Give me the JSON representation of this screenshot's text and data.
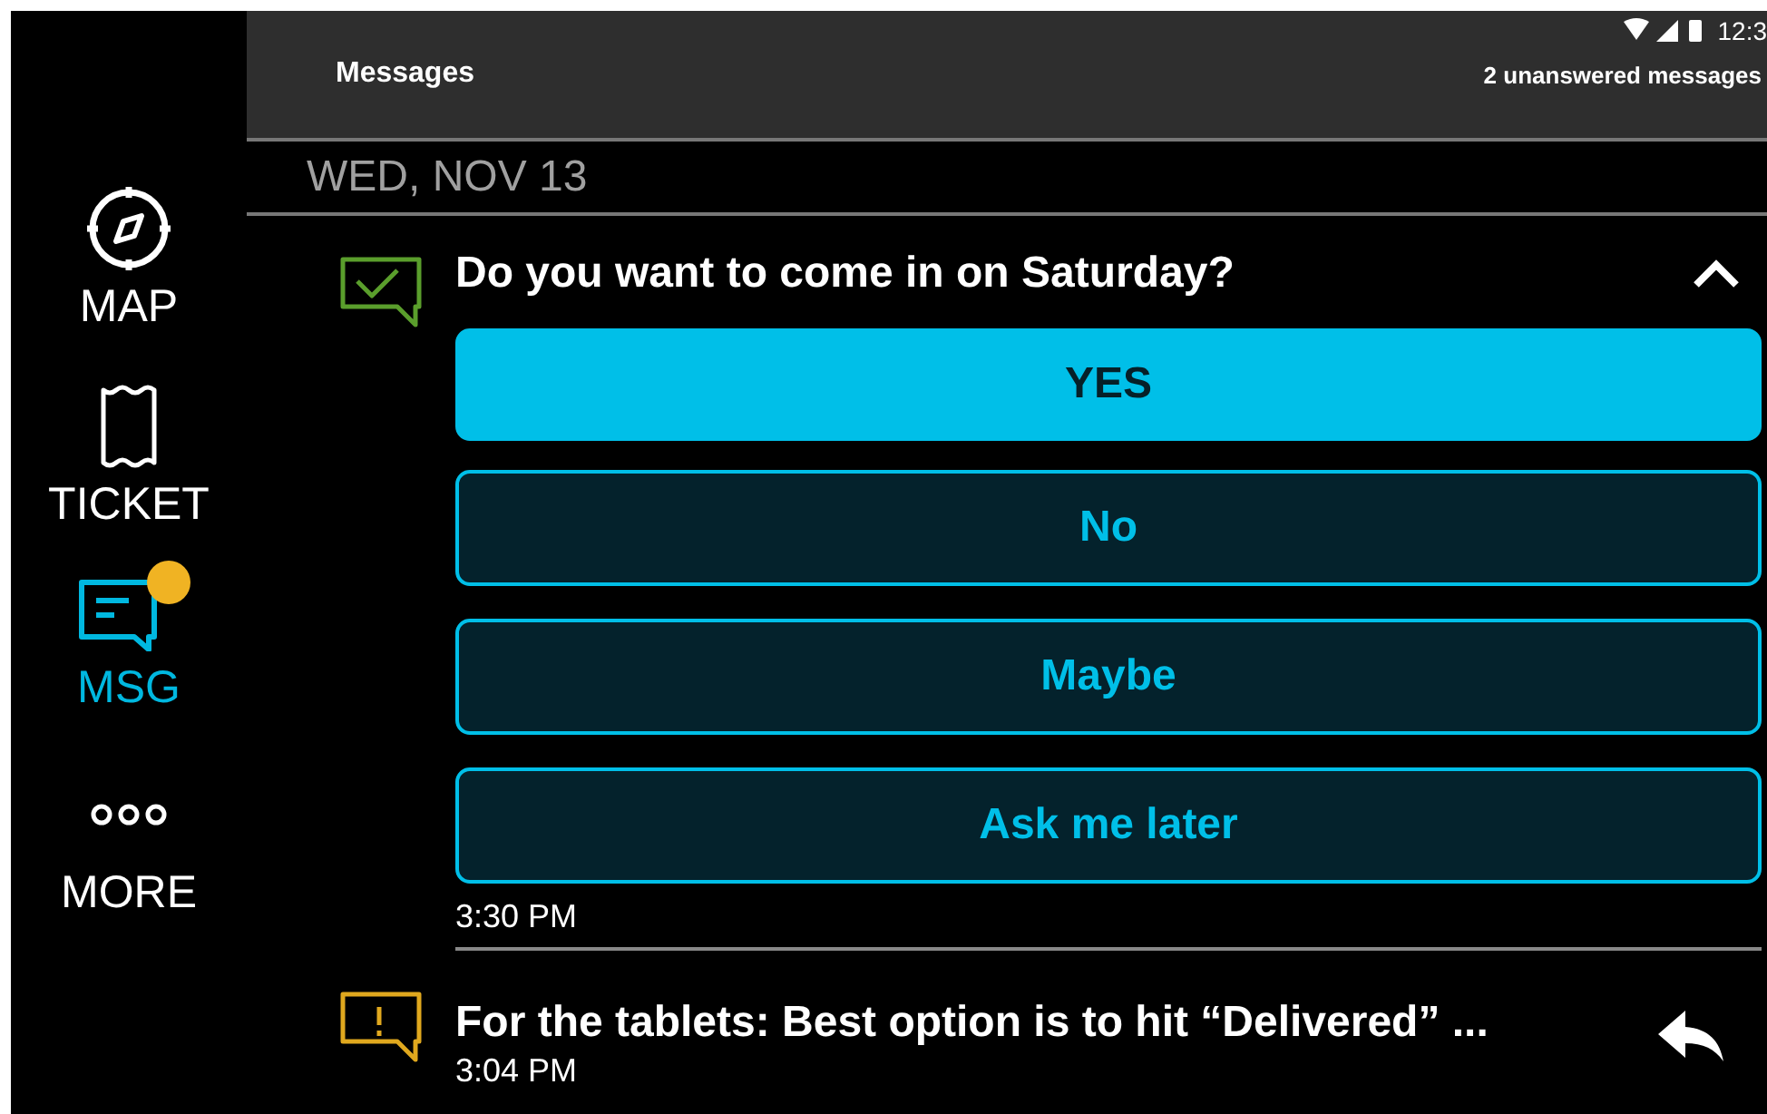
{
  "status_bar": {
    "time": "12:3"
  },
  "sidebar": {
    "items": [
      {
        "label": "MAP",
        "selected": false,
        "badge": false
      },
      {
        "label": "TICKET",
        "selected": false,
        "badge": false
      },
      {
        "label": "MSG",
        "selected": true,
        "badge": true
      },
      {
        "label": "MORE",
        "selected": false,
        "badge": false
      }
    ]
  },
  "header": {
    "title": "Messages",
    "summary": "2 unanswered messages"
  },
  "date": "WED, NOV 13",
  "messages": [
    {
      "kind": "question",
      "title": "Do you want to come in on Saturday?",
      "expanded": true,
      "options": [
        {
          "label": "YES",
          "selected": true
        },
        {
          "label": "No",
          "selected": false
        },
        {
          "label": "Maybe",
          "selected": false
        },
        {
          "label": "Ask me later",
          "selected": false
        }
      ],
      "time": "3:30 PM"
    },
    {
      "kind": "alert",
      "title": "For the tablets: Best option is to hit “Delivered” ...",
      "time": "3:04 PM"
    }
  ]
}
